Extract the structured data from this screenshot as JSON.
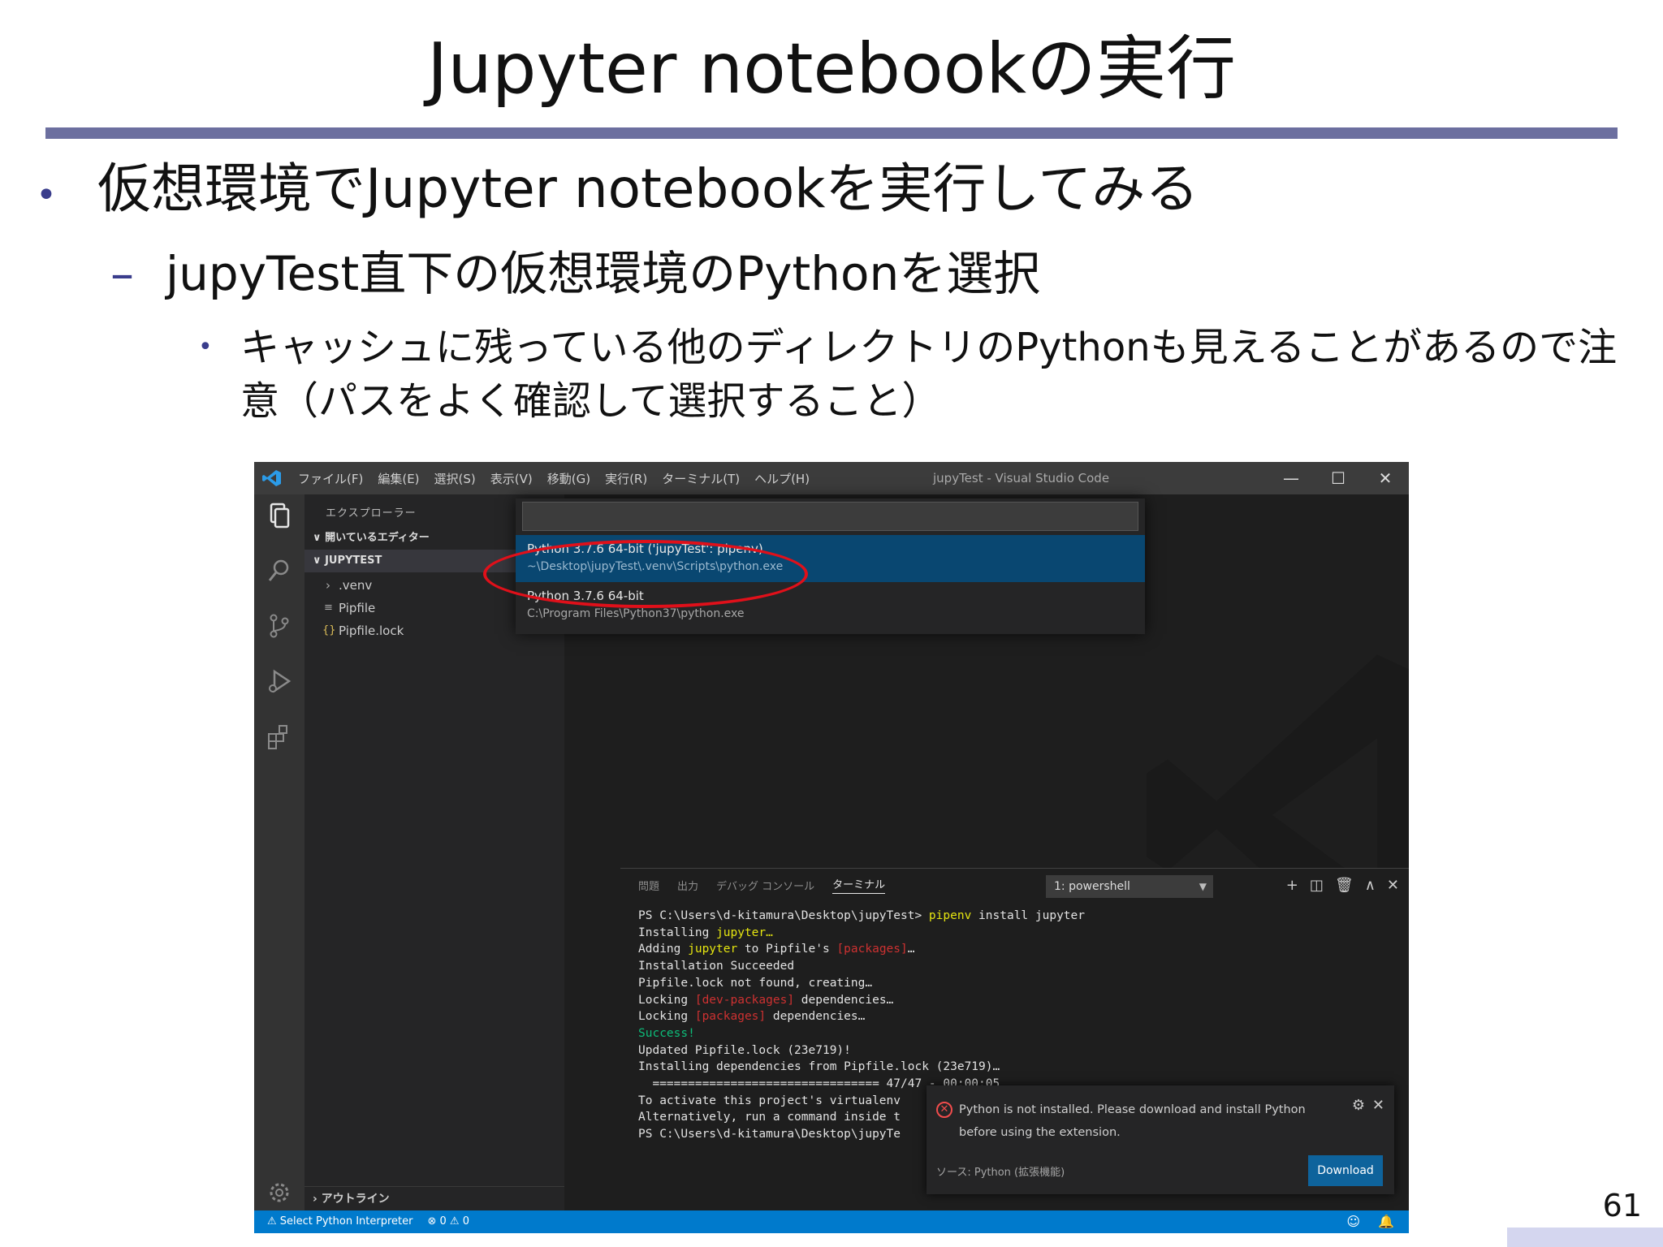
{
  "slide": {
    "title": "Jupyter notebookの実行",
    "bullet1": "仮想環境でJupyter notebookを実行してみる",
    "bullet2": "jupyTest直下の仮想環境のPythonを選択",
    "bullet3": "キャッシュに残っている他のディレクトリのPythonも見えることがあるので注意（パスをよく確認して選択すること）",
    "bullet_mark": "•",
    "dash_mark": "–",
    "page_number": "61"
  },
  "vscode": {
    "menu": [
      "ファイル(F)",
      "編集(E)",
      "選択(S)",
      "表示(V)",
      "移動(G)",
      "実行(R)",
      "ターミナル(T)",
      "ヘルプ(H)"
    ],
    "window_title": "jupyTest - Visual Studio Code",
    "window_buttons": {
      "minimize": "—",
      "maximize": "☐",
      "close": "✕"
    },
    "sidebar": {
      "title": "エクスプローラー",
      "open_editors": "∨ 開いているエディター",
      "workspace": "∨ JUPYTEST",
      "items": [
        {
          "icon": "›",
          "label": ".venv"
        },
        {
          "icon": "≡",
          "label": "Pipfile"
        },
        {
          "icon": "{}",
          "label": "Pipfile.lock"
        }
      ],
      "outline": "› アウトライン"
    },
    "quick_pick": {
      "items": [
        {
          "label": "Python 3.7.6 64-bit ('jupyTest': pipenv)",
          "path": "~\\Desktop\\jupyTest\\.venv\\Scripts\\python.exe"
        },
        {
          "label": "Python 3.7.6 64-bit",
          "path": "C:\\Program Files\\Python37\\python.exe"
        }
      ]
    },
    "panel": {
      "tabs": [
        "問題",
        "出力",
        "デバッグ コンソール",
        "ターミナル"
      ],
      "active_tab": "ターミナル",
      "terminal_select": "1: powershell",
      "actions": [
        "+",
        "◫",
        "🗑",
        "∧",
        "✕"
      ]
    },
    "terminal": {
      "l01a": "PS C:\\Users\\d-kitamura\\Desktop\\jupyTest> ",
      "l01b": "pipenv",
      "l01c": " install jupyter",
      "l02a": "Installing ",
      "l02b": "jupyter…",
      "l03a": "Adding ",
      "l03b": "jupyter",
      "l03c": " to Pipfile's ",
      "l03d": "[packages]",
      "l03e": "…",
      "l04": "Installation Succeeded",
      "l05": "Pipfile.lock not found, creating…",
      "l06a": "Locking ",
      "l06b": "[dev-packages]",
      "l06c": " dependencies…",
      "l07a": "Locking ",
      "l07b": "[packages]",
      "l07c": " dependencies…",
      "l08": "Success!",
      "l09": "Updated Pipfile.lock (23e719)!",
      "l10": "Installing dependencies from Pipfile.lock (23e719)…",
      "l11": "  ================================ 47/47 - 00:00:05",
      "l12": "To activate this project's virtualenv",
      "l13": "Alternatively, run a command inside t",
      "l14": "PS C:\\Users\\d-kitamura\\Desktop\\jupyTe"
    },
    "notification": {
      "message": "Python is not installed. Please download and install Python before using the extension.",
      "source": "ソース: Python (拡張機能)",
      "button": "Download"
    },
    "status": {
      "interpreter": "⚠ Select Python Interpreter",
      "problems": "⊗ 0 ⚠ 0",
      "right_icons": [
        "☺",
        "🔔"
      ]
    },
    "colors": {
      "status_bar": "#007acc",
      "selection": "#094771",
      "highlight_ellipse": "#e0101a",
      "title_rule": "#6c6f9f"
    }
  }
}
